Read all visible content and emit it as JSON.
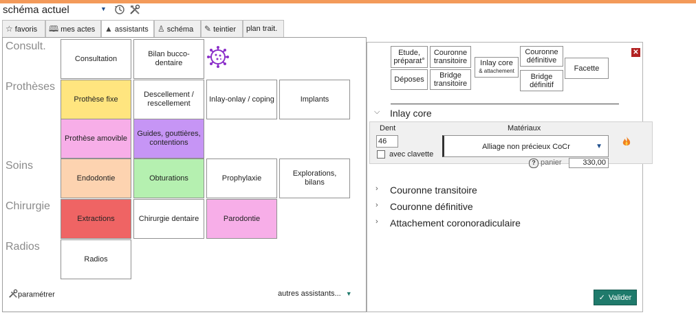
{
  "toolbar": {
    "schema_value": "schéma actuel",
    "history_icon": "history-icon",
    "tools_icon": "tools-icon"
  },
  "tabs": [
    {
      "label": "favoris",
      "icon": "star-icon"
    },
    {
      "label": "mes actes",
      "icon": "book-icon"
    },
    {
      "label": "assistants",
      "icon": "wizard-hat-icon"
    },
    {
      "label": "schéma",
      "icon": "tooth-icon"
    },
    {
      "label": "teintier",
      "icon": "brush-icon"
    },
    {
      "label": "plan trait.",
      "icon": ""
    }
  ],
  "categories": {
    "consult": "Consult.",
    "protheses": "Prothèses",
    "soins": "Soins",
    "chirurgie": "Chirurgie",
    "radios": "Radios"
  },
  "cells": {
    "consultation": "Consultation",
    "bilan": "Bilan bucco-dentaire",
    "prothese_fixe": "Prothèse fixe",
    "descellement": "Descellement / rescellement",
    "inlay_onlay": "Inlay-onlay / coping",
    "implants": "Implants",
    "prothese_amovible": "Prothèse amovible",
    "guides": "Guides, gouttières, contentions",
    "endodontie": "Endodontie",
    "obturations": "Obturations",
    "prophylaxie": "Prophylaxie",
    "explorations": "Explorations, bilans",
    "extractions": "Extractions",
    "chirurgie_dentaire": "Chirurgie dentaire",
    "parodontie": "Parodontie",
    "radios": "Radios"
  },
  "colors": {
    "prothese_fixe": "#ffe57f",
    "prothese_amovible": "#f7aee8",
    "guides": "#c695f5",
    "endodontie": "#fdd3b0",
    "obturations": "#b5f0b0",
    "extractions": "#ef6464",
    "parodontie": "#f7aee8",
    "accent": "#1f7a6b"
  },
  "footer": {
    "parametrer": "paramétrer",
    "autres": "autres assistants..."
  },
  "right": {
    "buttons": {
      "etude": "Etude, préparat°",
      "couronne_transitoire": "Couronne transitoire",
      "inlay_core": "Inlay core",
      "inlay_core_sub": "& attachement",
      "couronne_definitive": "Couronne définitive",
      "facette": "Facette",
      "deposes": "Déposes",
      "bridge_transitoire": "Bridge transitoire",
      "bridge_definitif": "Bridge définitif"
    },
    "section_open": "Inlay core",
    "dent_label": "Dent",
    "dent_value": "46",
    "avec_clavette": "avec clavette",
    "materiaux_label": "Matériaux",
    "materiaux_value": "Alliage non précieux CoCr",
    "panier": "panier",
    "price": "330,00",
    "sections": [
      "Couronne transitoire",
      "Couronne définitive",
      "Attachement coronoradiculaire"
    ],
    "valider": "Valider"
  }
}
